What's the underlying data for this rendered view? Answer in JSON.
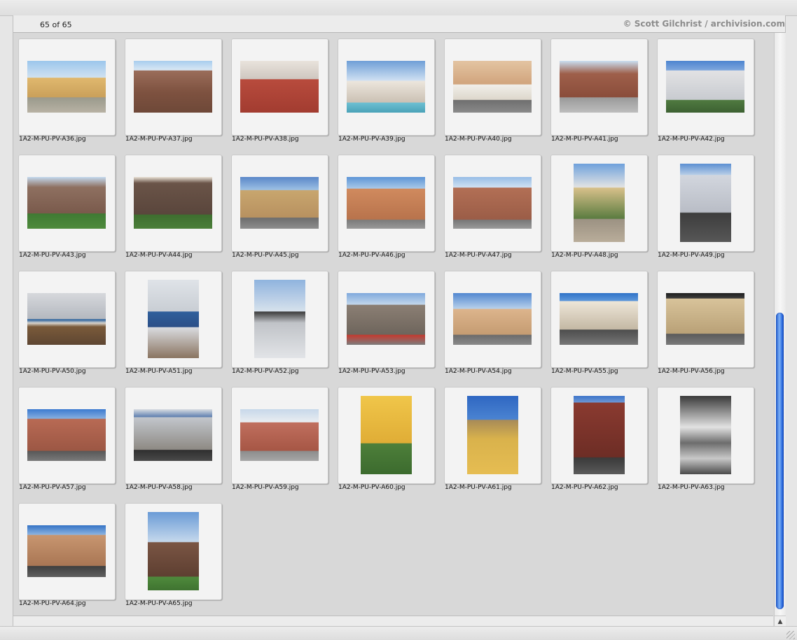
{
  "header": {
    "count_label": "65 of 65",
    "credit": "© Scott Gilchrist / archivision.com"
  },
  "grid": {
    "items": [
      {
        "filename": "1A2-M-PU-PV-A36.jpg",
        "icon": "photo-thumbnail"
      },
      {
        "filename": "1A2-M-PU-PV-A37.jpg",
        "icon": "photo-thumbnail"
      },
      {
        "filename": "1A2-M-PU-PV-A38.jpg",
        "icon": "photo-thumbnail"
      },
      {
        "filename": "1A2-M-PU-PV-A39.jpg",
        "icon": "photo-thumbnail"
      },
      {
        "filename": "1A2-M-PU-PV-A40.jpg",
        "icon": "photo-thumbnail"
      },
      {
        "filename": "1A2-M-PU-PV-A41.jpg",
        "icon": "photo-thumbnail"
      },
      {
        "filename": "1A2-M-PU-PV-A42.jpg",
        "icon": "photo-thumbnail"
      },
      {
        "filename": "1A2-M-PU-PV-A43.jpg",
        "icon": "photo-thumbnail"
      },
      {
        "filename": "1A2-M-PU-PV-A44.jpg",
        "icon": "photo-thumbnail"
      },
      {
        "filename": "1A2-M-PU-PV-A45.jpg",
        "icon": "photo-thumbnail"
      },
      {
        "filename": "1A2-M-PU-PV-A46.jpg",
        "icon": "photo-thumbnail"
      },
      {
        "filename": "1A2-M-PU-PV-A47.jpg",
        "icon": "photo-thumbnail"
      },
      {
        "filename": "1A2-M-PU-PV-A48.jpg",
        "icon": "photo-thumbnail"
      },
      {
        "filename": "1A2-M-PU-PV-A49.jpg",
        "icon": "photo-thumbnail"
      },
      {
        "filename": "1A2-M-PU-PV-A50.jpg",
        "icon": "photo-thumbnail"
      },
      {
        "filename": "1A2-M-PU-PV-A51.jpg",
        "icon": "photo-thumbnail"
      },
      {
        "filename": "1A2-M-PU-PV-A52.jpg",
        "icon": "photo-thumbnail"
      },
      {
        "filename": "1A2-M-PU-PV-A53.jpg",
        "icon": "photo-thumbnail"
      },
      {
        "filename": "1A2-M-PU-PV-A54.jpg",
        "icon": "photo-thumbnail"
      },
      {
        "filename": "1A2-M-PU-PV-A55.jpg",
        "icon": "photo-thumbnail"
      },
      {
        "filename": "1A2-M-PU-PV-A56.jpg",
        "icon": "photo-thumbnail"
      },
      {
        "filename": "1A2-M-PU-PV-A57.jpg",
        "icon": "photo-thumbnail"
      },
      {
        "filename": "1A2-M-PU-PV-A58.jpg",
        "icon": "photo-thumbnail"
      },
      {
        "filename": "1A2-M-PU-PV-A59.jpg",
        "icon": "photo-thumbnail"
      },
      {
        "filename": "1A2-M-PU-PV-A60.jpg",
        "icon": "photo-thumbnail"
      },
      {
        "filename": "1A2-M-PU-PV-A61.jpg",
        "icon": "photo-thumbnail"
      },
      {
        "filename": "1A2-M-PU-PV-A62.jpg",
        "icon": "photo-thumbnail"
      },
      {
        "filename": "1A2-M-PU-PV-A63.jpg",
        "icon": "photo-thumbnail"
      },
      {
        "filename": "1A2-M-PU-PV-A64.jpg",
        "icon": "photo-thumbnail"
      },
      {
        "filename": "1A2-M-PU-PV-A65.jpg",
        "icon": "photo-thumbnail"
      }
    ]
  },
  "scrollbar": {
    "up_arrow_icon": "arrow-up-icon",
    "down_arrow_icon": "arrow-down-icon",
    "thumb_color": "#2b6be0"
  }
}
